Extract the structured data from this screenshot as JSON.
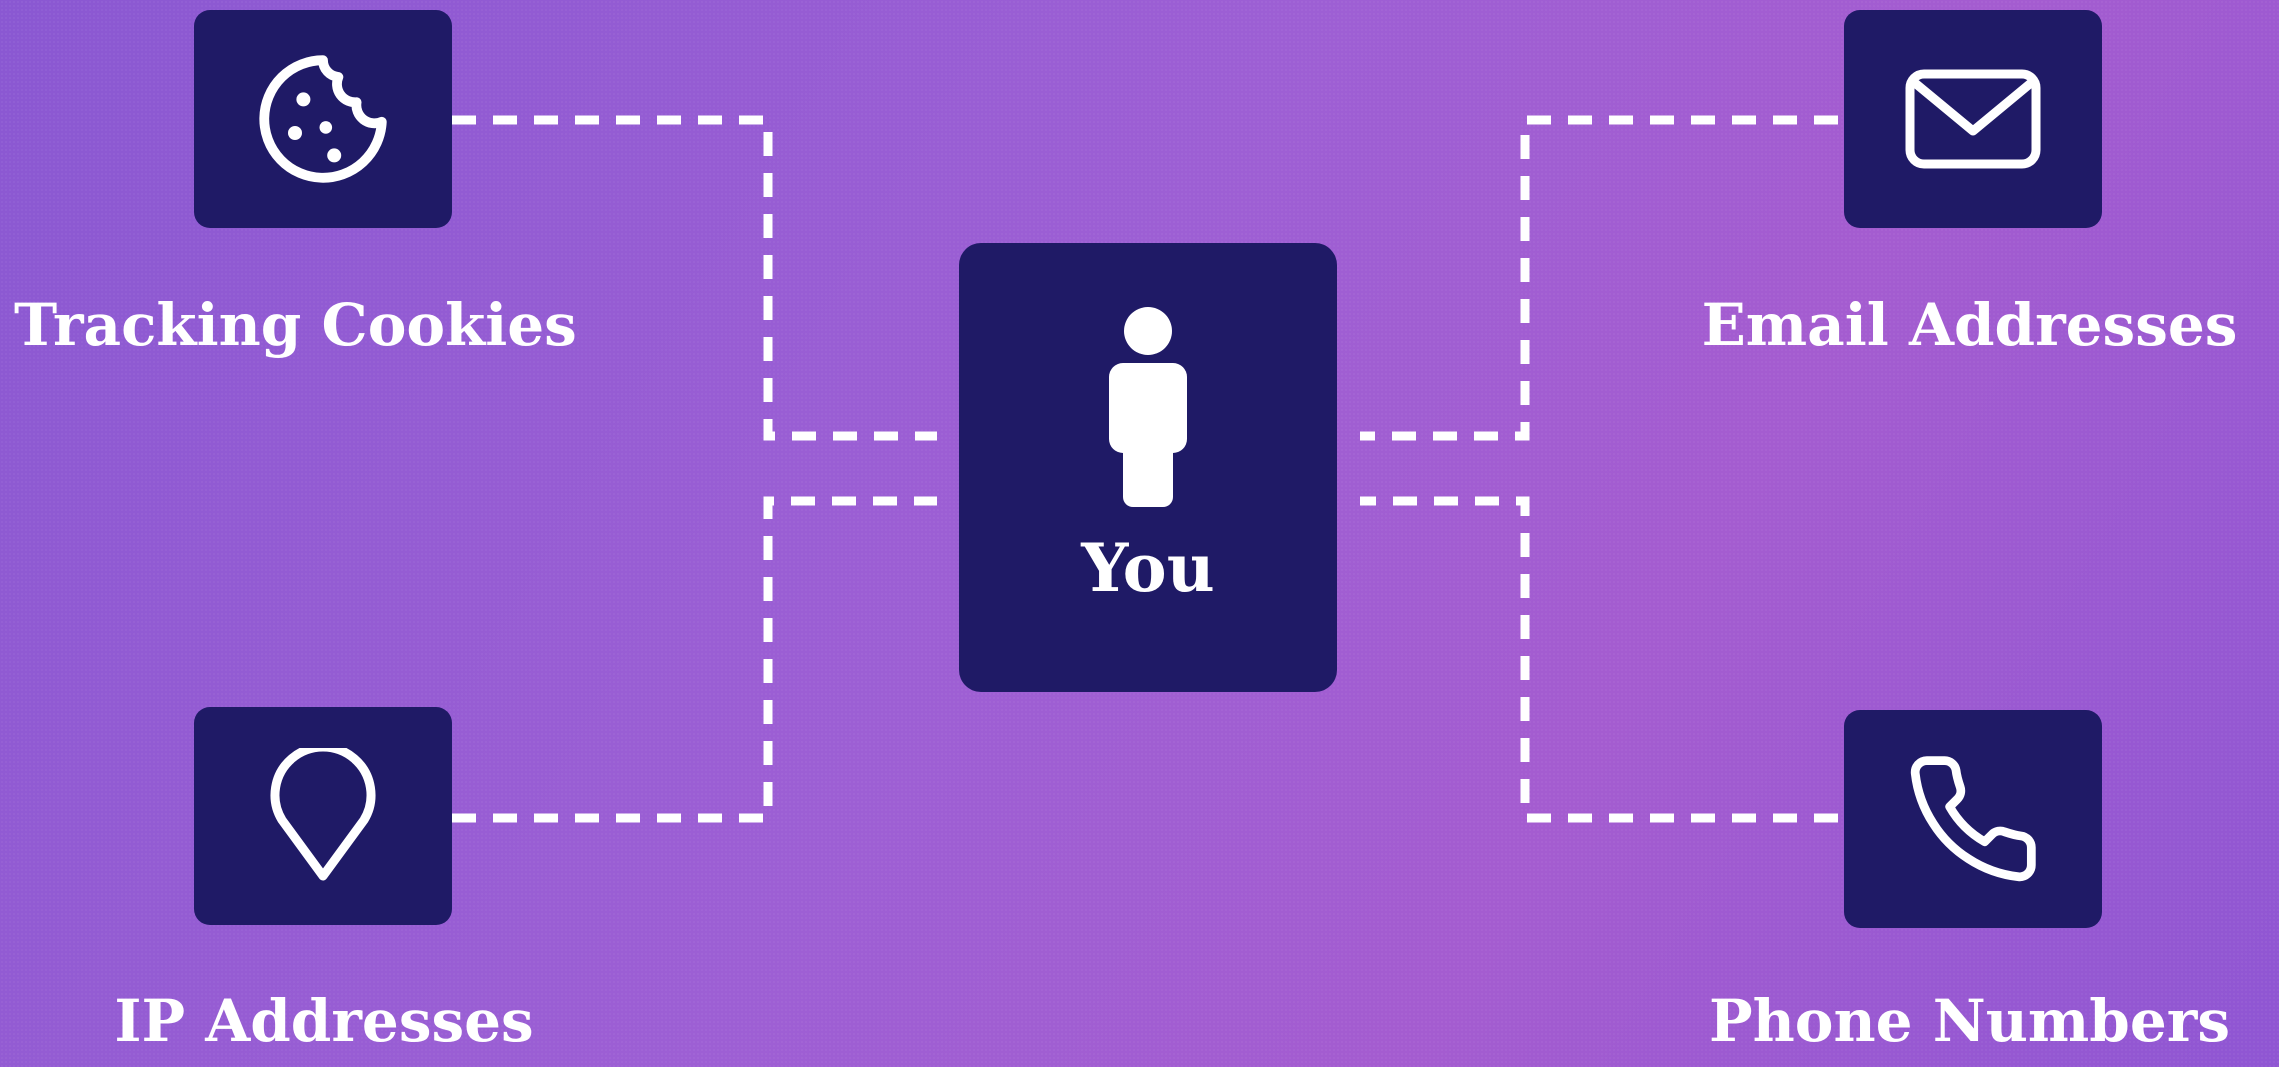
{
  "center": {
    "label": "You",
    "icon": "person-icon"
  },
  "nodes": [
    {
      "id": "tracking-cookies",
      "label": "Tracking Cookies",
      "icon": "cookie-icon"
    },
    {
      "id": "email-addresses",
      "label": "Email Addresses",
      "icon": "envelope-icon"
    },
    {
      "id": "ip-addresses",
      "label": "IP Addresses",
      "icon": "location-pin-icon"
    },
    {
      "id": "phone-numbers",
      "label": "Phone Numbers",
      "icon": "phone-icon"
    }
  ],
  "colors": {
    "tile": "#1f1a66",
    "foreground": "#ffffff",
    "background_start": "#8a58d2",
    "background_end": "#a45cd0"
  }
}
